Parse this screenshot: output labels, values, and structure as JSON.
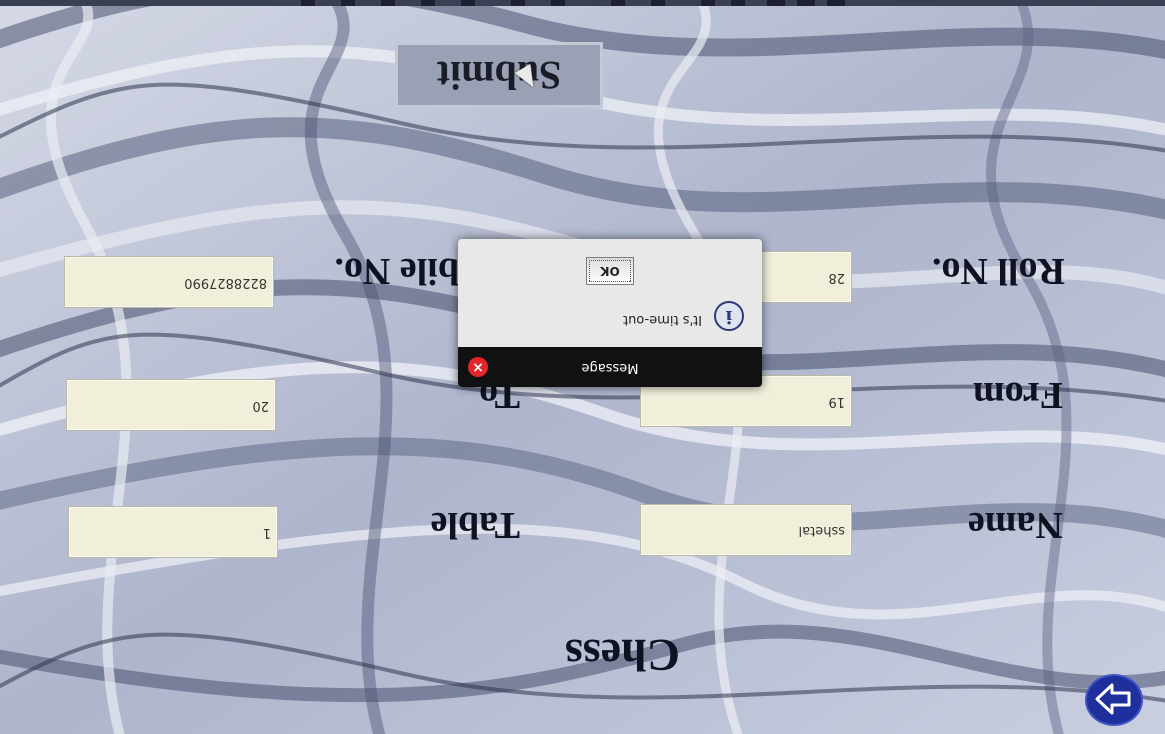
{
  "app": {
    "title": "Chess"
  },
  "form": {
    "name_label": "Name",
    "name_value": "sshetal",
    "table_label": "Table",
    "table_value": "1",
    "from_label": "From",
    "from_value": "19",
    "to_label": "To",
    "to_value": "20",
    "roll_label": "Roll No.",
    "roll_value": "28",
    "mobile_label": "bile No.",
    "mobile_value": "8228827990",
    "submit_label": "Submit"
  },
  "dialog": {
    "title": "Message",
    "message": "It's time-out",
    "ok_label": "OK",
    "info_glyph": "i",
    "close_glyph": "×"
  },
  "icons": {
    "next": "arrow-right-icon",
    "info": "info-icon",
    "close": "close-icon"
  },
  "colors": {
    "field_bg": "#f1efda",
    "submit_bg": "#9aa1b4",
    "dialog_title_bg": "#111111",
    "close_red": "#e2262c",
    "next_blue": "#1f2f9c"
  }
}
